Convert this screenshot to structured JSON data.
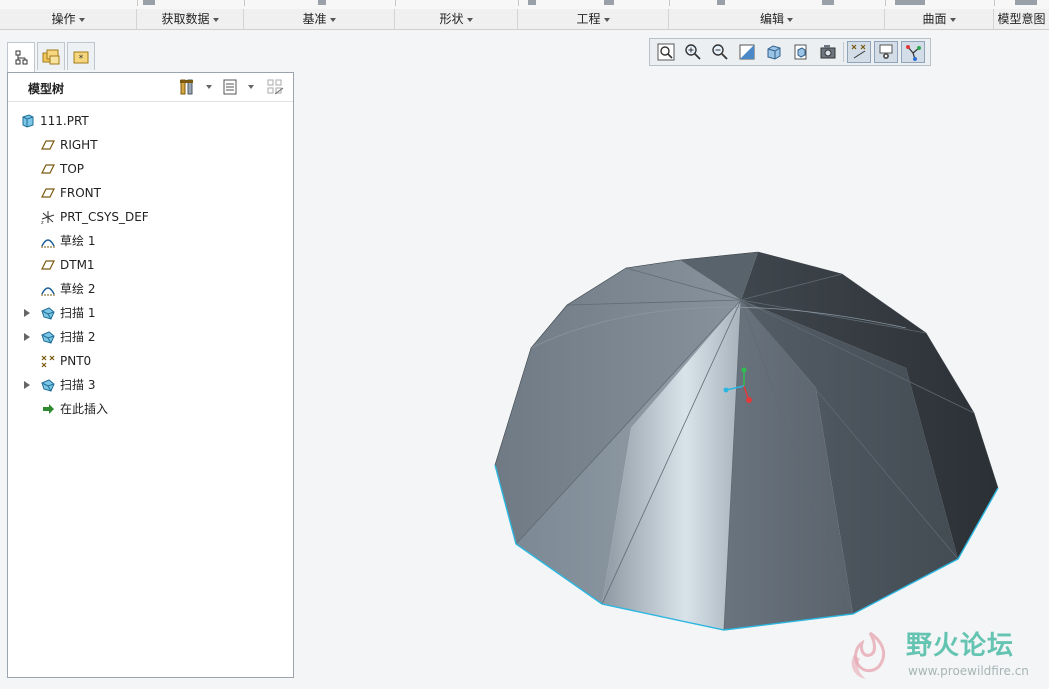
{
  "ribbon_groups": [
    {
      "label": "操作"
    },
    {
      "label": "获取数据"
    },
    {
      "label": "基准"
    },
    {
      "label": "形状"
    },
    {
      "label": "工程"
    },
    {
      "label": "编辑"
    },
    {
      "label": "曲面"
    },
    {
      "label": "模型意图"
    }
  ],
  "model_tree": {
    "title": "模型树",
    "items": [
      {
        "label": "111.PRT",
        "icon": "part-icon",
        "expandable": false
      },
      {
        "label": "RIGHT",
        "icon": "datum-plane-icon",
        "expandable": false
      },
      {
        "label": "TOP",
        "icon": "datum-plane-icon",
        "expandable": false
      },
      {
        "label": "FRONT",
        "icon": "datum-plane-icon",
        "expandable": false
      },
      {
        "label": "PRT_CSYS_DEF",
        "icon": "csys-icon",
        "expandable": false
      },
      {
        "label": "草绘 1",
        "icon": "sketch-icon",
        "expandable": false
      },
      {
        "label": "DTM1",
        "icon": "datum-plane-icon",
        "expandable": false
      },
      {
        "label": "草绘 2",
        "icon": "sketch-icon",
        "expandable": false
      },
      {
        "label": "扫描 1",
        "icon": "sweep-icon",
        "expandable": true
      },
      {
        "label": "扫描 2",
        "icon": "sweep-icon",
        "expandable": true
      },
      {
        "label": "PNT0",
        "icon": "datum-point-icon",
        "expandable": false
      },
      {
        "label": "扫描 3",
        "icon": "sweep-icon",
        "expandable": true
      },
      {
        "label": "在此插入",
        "icon": "insert-here-arrow-icon",
        "expandable": false
      }
    ]
  },
  "view_toolbar": {
    "buttons": [
      "refit-icon",
      "zoom-in-icon",
      "zoom-out-icon",
      "repaint-icon",
      "display-style-icon",
      "saved-orientations-icon",
      "view-manager-icon",
      "datum-display-icon",
      "spin-center-icon",
      "annotation-display-icon"
    ]
  },
  "watermark": {
    "brand": "野火论坛",
    "url": "www.proewildfire.cn"
  },
  "colors": {
    "accent": "#1f8fd6",
    "model_edge": "#2bb6e0",
    "watermark": "#36b49a"
  }
}
